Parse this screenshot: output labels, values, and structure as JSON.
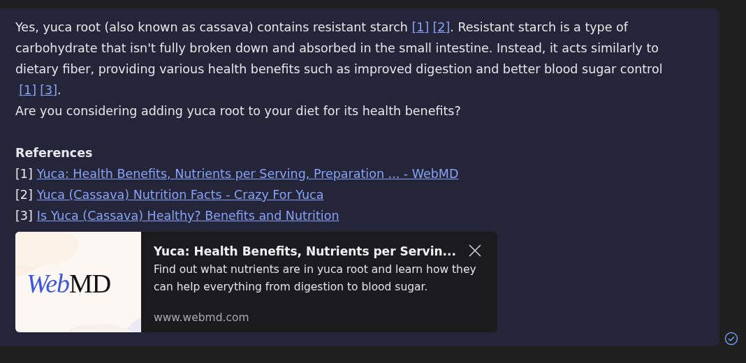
{
  "message": {
    "answer": [
      {
        "kind": "text",
        "text": "Yes, yuca root (also known as cassava) contains resistant starch "
      },
      {
        "kind": "cite",
        "text": "[1]"
      },
      {
        "kind": "cite",
        "text": "[2]"
      },
      {
        "kind": "text",
        "text": ". Resistant starch is a type of carbohydrate that isn't fully broken down and absorbed in the small intestine. Instead, it acts similarly to dietary fiber, providing various health benefits such as improved digestion and better blood sugar control "
      },
      {
        "kind": "cite",
        "text": "[1]"
      },
      {
        "kind": "cite",
        "text": "[3]"
      },
      {
        "kind": "text",
        "text": "."
      }
    ],
    "question": "Are you considering adding yuca root to your diet for its health benefits?",
    "references_title": "References",
    "references": [
      {
        "number": "[1]",
        "title": "Yuca: Health Benefits, Nutrients per Serving, Preparation ... - WebMD"
      },
      {
        "number": "[2]",
        "title": "Yuca (Cassava) Nutrition Facts - Crazy For Yuca"
      },
      {
        "number": "[3]",
        "title": "Is Yuca (Cassava) Healthy? Benefits and Nutrition"
      }
    ],
    "preview": {
      "logo": {
        "italic": "Web",
        "plain": "MD"
      },
      "title": "Yuca: Health Benefits, Nutrients per Servin...",
      "description": "Find out what nutrients are in yuca root and learn how they can help everything from digestion to blood sugar.",
      "domain": "www.webmd.com"
    }
  }
}
